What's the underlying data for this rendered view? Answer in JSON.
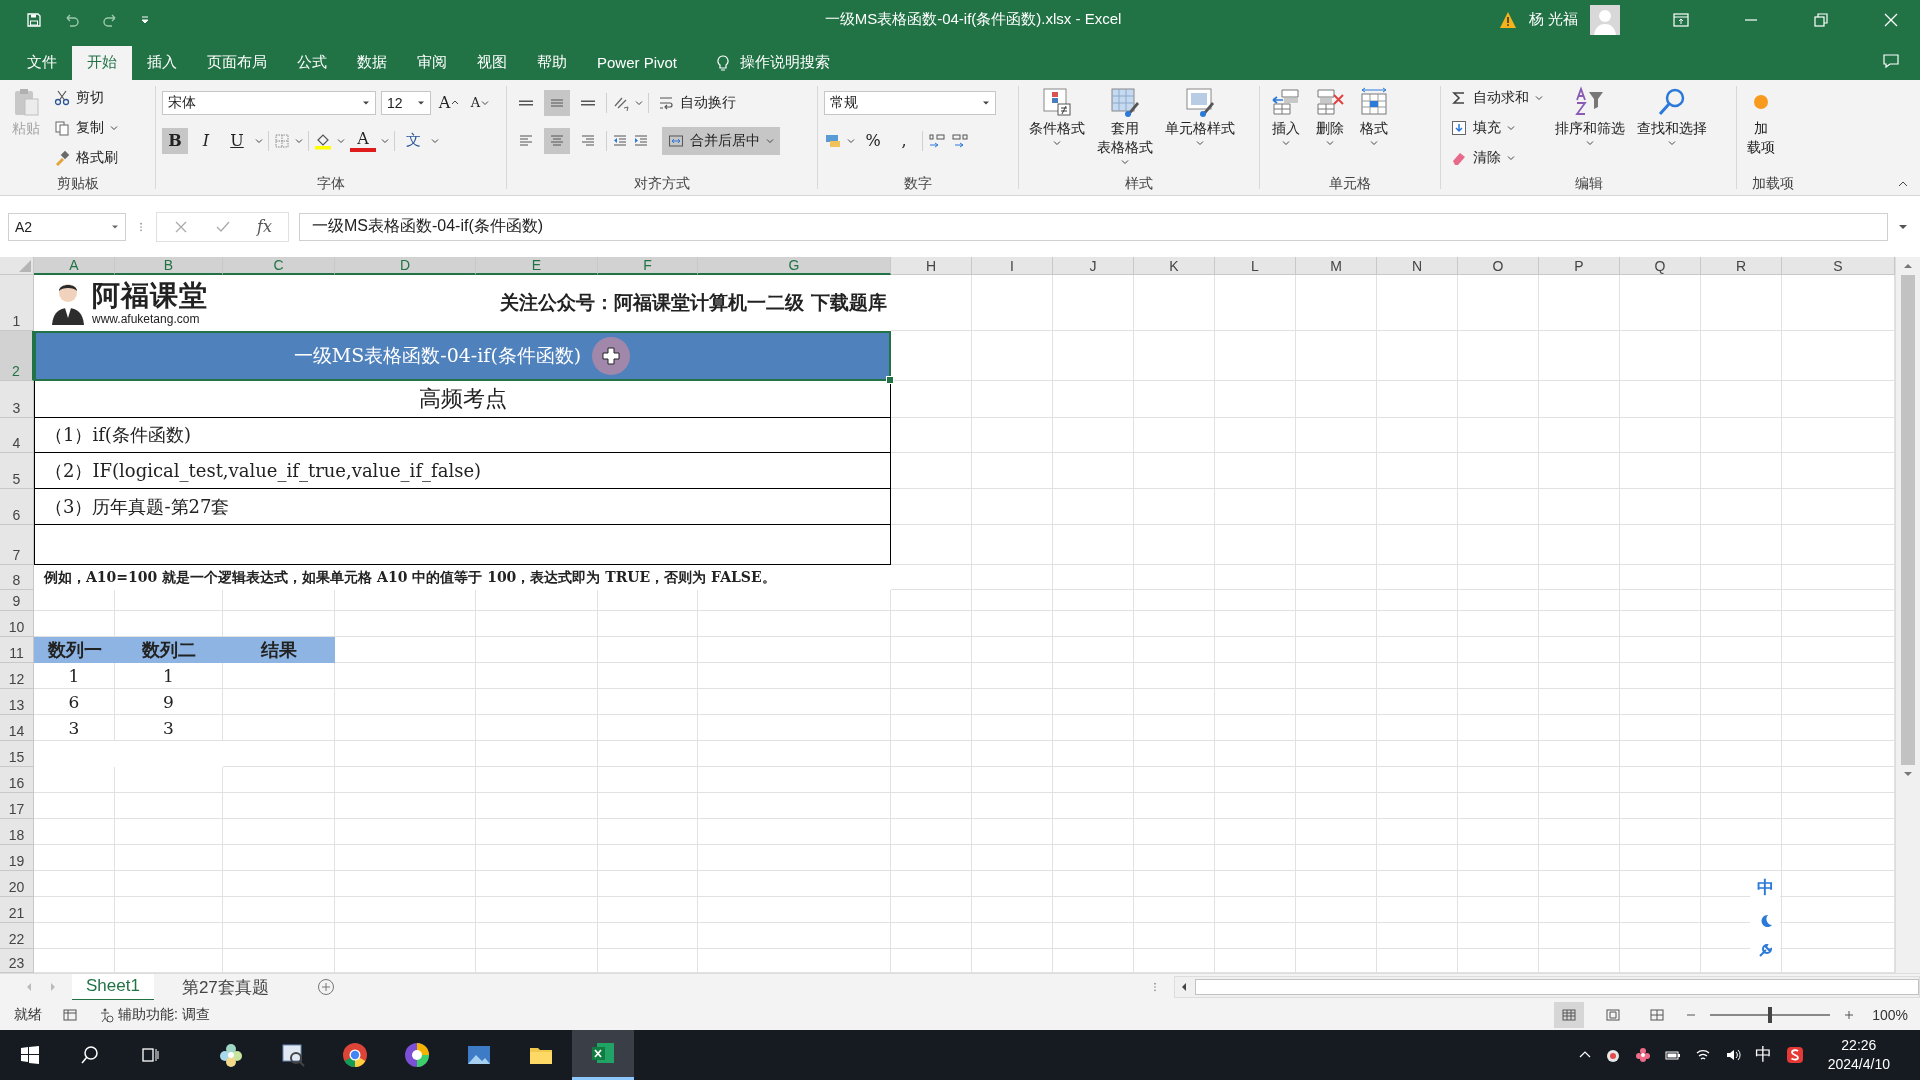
{
  "title_bar": {
    "title": "一级MS表格函数-04-if(条件函数).xlsx  -  Excel",
    "user": "杨 光福"
  },
  "menu_tabs": [
    {
      "label": "文件",
      "selected": false
    },
    {
      "label": "开始",
      "selected": true
    },
    {
      "label": "插入",
      "selected": false
    },
    {
      "label": "页面布局",
      "selected": false
    },
    {
      "label": "公式",
      "selected": false
    },
    {
      "label": "数据",
      "selected": false
    },
    {
      "label": "审阅",
      "selected": false
    },
    {
      "label": "视图",
      "selected": false
    },
    {
      "label": "帮助",
      "selected": false
    },
    {
      "label": "Power Pivot",
      "selected": false
    }
  ],
  "tell_me": "操作说明搜索",
  "clipboard": {
    "label": "剪贴板",
    "paste": {
      "label": "粘贴",
      "disabled": true
    },
    "actions": [
      "剪切",
      "复制",
      "格式刷"
    ]
  },
  "font": {
    "label": "字体",
    "family": "宋体",
    "size": "12",
    "grow": "A",
    "shrink": "A",
    "styles": [
      {
        "label": "B",
        "selected": true
      },
      {
        "label": "I",
        "selected": false
      },
      {
        "label": "U",
        "selected": false
      }
    ],
    "color_letter": "A",
    "phonetic": "文"
  },
  "alignment": {
    "label": "对齐方式",
    "vertical": [
      {
        "selected": false
      },
      {
        "selected": true
      },
      {
        "selected": false
      }
    ],
    "horizontal": [
      {
        "selected": false
      },
      {
        "selected": true
      },
      {
        "selected": false
      }
    ],
    "wrap": "自动换行",
    "merge": {
      "label": "合并后居中",
      "selected": true
    }
  },
  "number": {
    "label": "数字",
    "format": "常规",
    "percent": "%",
    "comma": ","
  },
  "styles": {
    "label": "样式",
    "buttons": [
      [
        "条件格式"
      ],
      [
        "套用",
        "表格格式"
      ],
      [
        "单元格样式"
      ]
    ]
  },
  "cells": {
    "label": "单元格",
    "buttons": [
      "插入",
      "删除",
      "格式"
    ]
  },
  "editing": {
    "label": "编辑",
    "small": [
      "自动求和",
      "填充",
      "清除"
    ],
    "big": [
      "排序和筛选",
      "查找和选择"
    ]
  },
  "addins": {
    "label": "加载项",
    "button": [
      "加",
      "载项"
    ]
  },
  "formula_bar": {
    "name_box": "A2",
    "fx": "fx",
    "formula": "一级MS表格函数-04-if(条件函数)"
  },
  "sheet": {
    "columns": [
      {
        "label": "A",
        "selected": true
      },
      {
        "label": "B",
        "selected": true
      },
      {
        "label": "C",
        "selected": true
      },
      {
        "label": "D",
        "selected": true
      },
      {
        "label": "E",
        "selected": true
      },
      {
        "label": "F",
        "selected": true
      },
      {
        "label": "G",
        "selected": true
      },
      {
        "label": "H",
        "selected": false
      },
      {
        "label": "I",
        "selected": false
      },
      {
        "label": "J",
        "selected": false
      },
      {
        "label": "K",
        "selected": false
      },
      {
        "label": "L",
        "selected": false
      },
      {
        "label": "M",
        "selected": false
      },
      {
        "label": "N",
        "selected": false
      },
      {
        "label": "O",
        "selected": false
      },
      {
        "label": "P",
        "selected": false
      },
      {
        "label": "Q",
        "selected": false
      },
      {
        "label": "R",
        "selected": false
      },
      {
        "label": "S",
        "selected": false
      }
    ],
    "rows": [
      {
        "label": "1",
        "selected": false
      },
      {
        "label": "2",
        "selected": true
      },
      {
        "label": "3",
        "selected": false
      },
      {
        "label": "4",
        "selected": false
      },
      {
        "label": "5",
        "selected": false
      },
      {
        "label": "6",
        "selected": false
      },
      {
        "label": "7",
        "selected": false
      },
      {
        "label": "8",
        "selected": false
      },
      {
        "label": "9",
        "selected": false
      },
      {
        "label": "10",
        "selected": false
      },
      {
        "label": "11",
        "selected": false
      },
      {
        "label": "12",
        "selected": false
      },
      {
        "label": "13",
        "selected": false
      },
      {
        "label": "14",
        "selected": false
      },
      {
        "label": "15",
        "selected": false
      },
      {
        "label": "16",
        "selected": false
      },
      {
        "label": "17",
        "selected": false
      },
      {
        "label": "18",
        "selected": false
      },
      {
        "label": "19",
        "selected": false
      },
      {
        "label": "20",
        "selected": false
      },
      {
        "label": "21",
        "selected": false
      },
      {
        "label": "22",
        "selected": false
      },
      {
        "label": "23",
        "selected": false
      }
    ],
    "logo": {
      "brand": "阿福课堂",
      "url": "www.afuketang.com"
    },
    "notice": "关注公众号：阿福课堂计算机一二级  下载题库",
    "banner": {
      "text": "一级MS表格函数-04-if(条件函数)",
      "selected": true
    },
    "heading": "高频考点",
    "points": [
      "（1）if(条件函数)",
      "（2）IF(logical_test,value_if_true,value_if_false)",
      "（3）历年真题-第27套"
    ],
    "note": "例如，A10=100 就是一个逻辑表达式，如果单元格 A10 中的值等于 100，表达式即为 TRUE，否则为 FALSE。",
    "table": {
      "headers": [
        "数列一",
        "数列二",
        "结果"
      ],
      "rows": [
        [
          "1",
          "1"
        ],
        [
          "6",
          "9"
        ],
        [
          "3",
          "3"
        ]
      ]
    }
  },
  "sheet_tabs": [
    {
      "label": "Sheet1",
      "selected": true
    },
    {
      "label": "第27套真题",
      "selected": false
    }
  ],
  "status_bar": {
    "ready": "就绪",
    "accessibility": "辅助功能: 调查",
    "views": [
      {
        "selected": true
      },
      {
        "selected": false
      },
      {
        "selected": false
      }
    ],
    "zoom": {
      "level": 0.5,
      "reading": "100%"
    }
  },
  "ime_bar": {
    "mode": "中"
  },
  "taskbar": {
    "apps": [
      {
        "selected": false
      },
      {
        "selected": false
      },
      {
        "selected": false
      },
      {
        "selected": false
      },
      {
        "selected": false
      },
      {
        "selected": false
      },
      {
        "selected": true
      }
    ],
    "ime": "中",
    "time": "22:26",
    "date": "2024/4/10"
  }
}
